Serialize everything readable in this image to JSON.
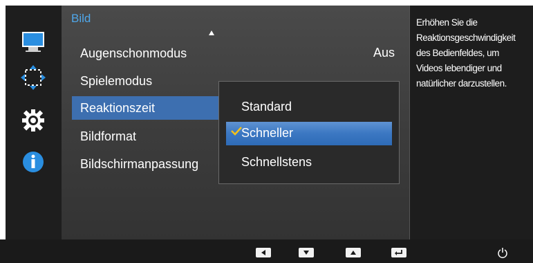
{
  "menu": {
    "title": "Bild",
    "items": [
      {
        "label": "Augenschonmodus",
        "value": "Aus"
      },
      {
        "label": "Spielemodus"
      },
      {
        "label": "Reaktionszeit"
      },
      {
        "label": "Bildformat"
      },
      {
        "label": "Bildschirmanpassung"
      }
    ]
  },
  "dropdown": {
    "options": [
      "Standard",
      "Schneller",
      "Schnellstens"
    ],
    "selected": "Schneller"
  },
  "help": {
    "text": "Erhöhen Sie die Reaktionsgeschwindigkeit des Bedienfeldes, um Videos lebendiger und natürlicher darzustellen."
  },
  "sidebar": {
    "icons": [
      "monitor-icon",
      "move-arrows-icon",
      "gear-icon",
      "info-icon"
    ]
  },
  "bottom_bar": {
    "icons": [
      "left-arrow-icon",
      "down-arrow-icon",
      "up-arrow-icon",
      "enter-icon",
      "power-icon"
    ]
  },
  "colors": {
    "accent": "#4fa7ea",
    "selected_item": "#3d6fb0",
    "dropdown_selected": "#3b77c2",
    "check": "#f3c21a"
  }
}
